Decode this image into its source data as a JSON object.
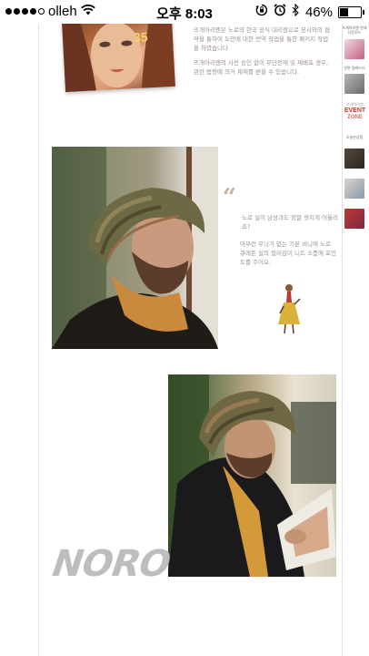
{
  "status_bar": {
    "carrier": "olleh",
    "time": "오후 8:03",
    "battery": "46%",
    "battery_level": 0.46,
    "signal_bars": 4,
    "icons": [
      "wifi-icon",
      "rotation-lock-icon",
      "alarm-icon",
      "bluetooth-icon",
      "battery-icon"
    ]
  },
  "intro": {
    "cover_number": "35",
    "paragraph1": "뜨개아리엔은 노로의 한국 공식 대리점으로 본사와의 협약을 통하여 도안에 대한 번역 작업을 통한 패키지 작업을 하였습니다.",
    "paragraph2": "뜨개아리엔의 사전 승인 없이 무단전재 및 재배포 경우, 관련 법령에 의거 제재를 받을 수 있습니다."
  },
  "quote": {
    "mark": "“",
    "question": "노로 실이 남성과도 정말 멋지게 어울리죠?",
    "answer": "아무런 무늬가 없는 기본 비니에 노로 큐레돈 실의 컬러감이 니트 소품에 포인트를 주어요."
  },
  "brand": {
    "logo": "NORO"
  },
  "sidebar": {
    "label1": "뜨개아리엔 연재 다운로드",
    "label2": "안면 털레드리",
    "event_top": "뜨개아리엔",
    "event_text": "EVENT",
    "event_bottom": "ZONE",
    "label3": "오늘본상품",
    "accent_color": "#c0392b"
  },
  "colors": {
    "body_text": "#9a8f8a",
    "quote_mark": "#c8b2a8",
    "logo_gray": "#bdbdbd"
  }
}
